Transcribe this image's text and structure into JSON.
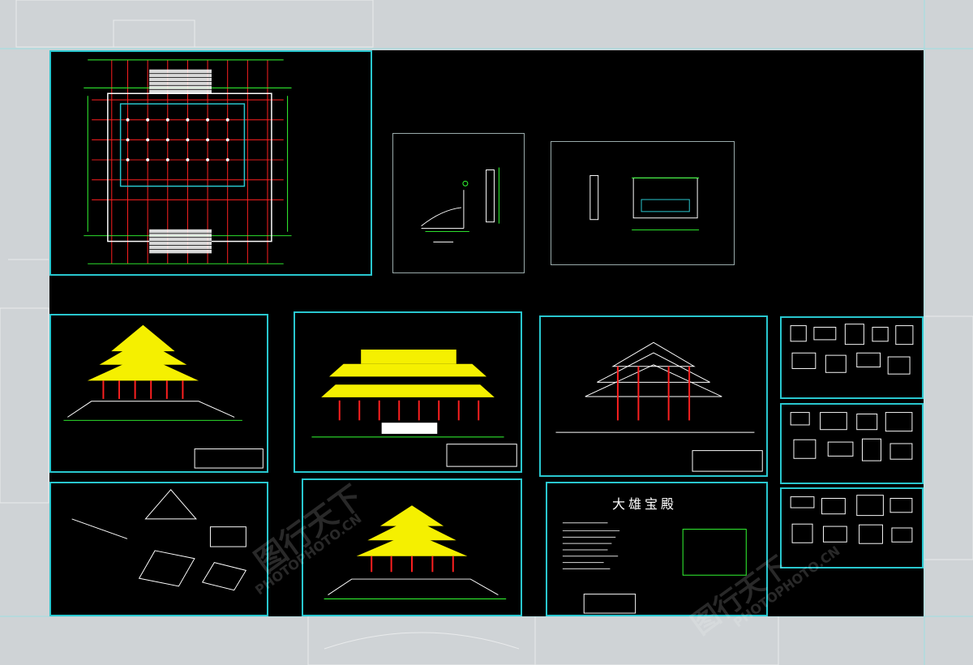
{
  "drawing": {
    "main_title": "大雄宝殿"
  },
  "watermark": {
    "brand": "PHOTOPHOTO.CN",
    "brand_cn": "图行天下"
  },
  "colors": {
    "sheet_border": "#29c7cf",
    "roof_yellow": "#f5f000",
    "column_red": "#ff2020",
    "plan_green": "#33ff33",
    "background": "#000000"
  },
  "icons": [
    "floor-plan-drawing",
    "elevation-drawing",
    "section-drawing",
    "detail-drawing",
    "watermark-logo"
  ]
}
